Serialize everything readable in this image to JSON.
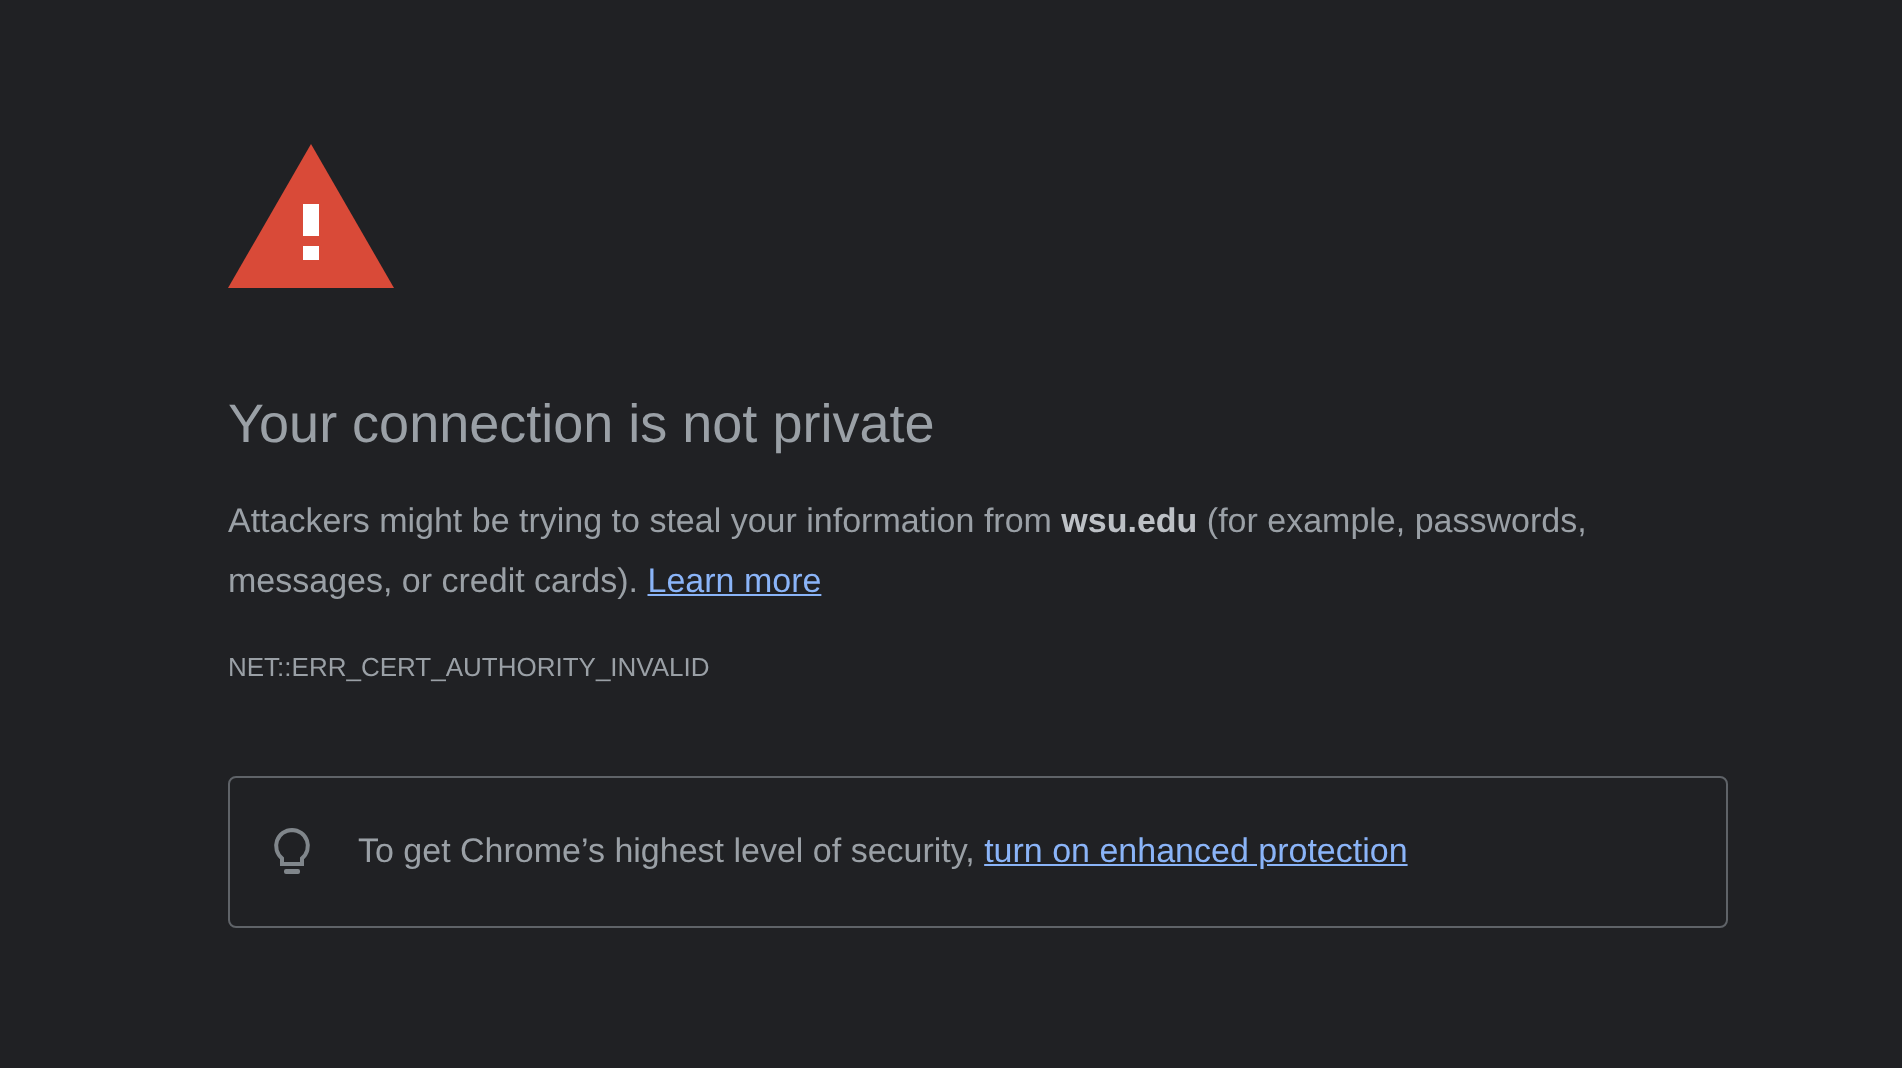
{
  "heading": "Your connection is not private",
  "description": {
    "text": "Attackers might be trying to steal your information from **wsu.edu** (for example, passwords, messages, or credit cards).",
    "link": "Learn more"
  },
  "error_code": "NET::ERR_CERT_AUTHORITY_INVALID",
  "protection_tip": {
    "text": "To get Chrome’s highest level of security,",
    "link": "turn on enhanced protection"
  }
}
